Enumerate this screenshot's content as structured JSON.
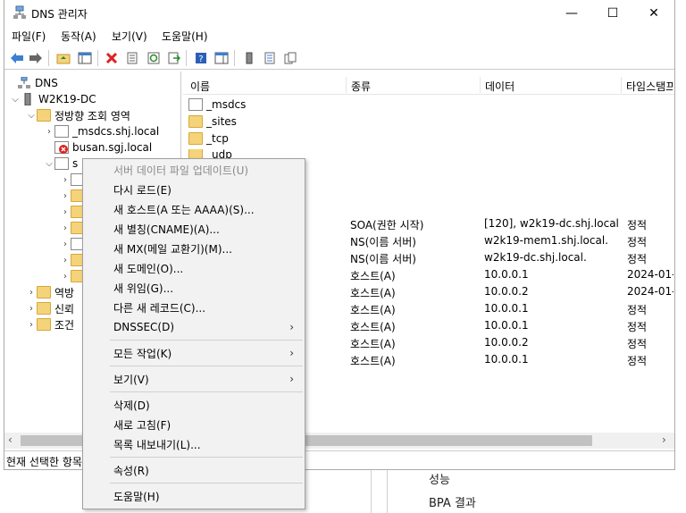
{
  "window": {
    "title": "DNS 관리자",
    "controls": {
      "minimize": "—",
      "maximize": "☐",
      "close": "✕"
    }
  },
  "menubar": [
    "파일(F)",
    "동작(A)",
    "보기(V)",
    "도움말(H)"
  ],
  "tree": {
    "root": "DNS",
    "server": "W2K19-DC",
    "forward_zones": "정방향 조회 영역",
    "zones": [
      "_msdcs.shj.local",
      "busan.sgj.local",
      "s"
    ],
    "others": [
      "역방",
      "신뢰",
      "조건"
    ]
  },
  "list": {
    "columns": [
      "이름",
      "종류",
      "데이터",
      "타임스탬프"
    ],
    "folders": [
      "_msdcs",
      "_sites",
      "_tcp",
      "_udp"
    ],
    "records": [
      {
        "type": "SOA(권한 시작)",
        "data": "[120], w2k19-dc.shj.local....",
        "ts": "정적"
      },
      {
        "type": "NS(이름 서버)",
        "data": "w2k19-mem1.shj.local.",
        "ts": "정적"
      },
      {
        "type": "NS(이름 서버)",
        "data": "w2k19-dc.shj.local.",
        "ts": "정적"
      },
      {
        "type": "호스트(A)",
        "data": "10.0.0.1",
        "ts": "2024-01-"
      },
      {
        "type": "호스트(A)",
        "data": "10.0.0.2",
        "ts": "2024-01-"
      },
      {
        "type": "호스트(A)",
        "data": "10.0.0.1",
        "ts": "정적"
      },
      {
        "type": "호스트(A)",
        "data": "10.0.0.1",
        "ts": "정적"
      },
      {
        "type": "호스트(A)",
        "data": "10.0.0.2",
        "ts": "정적"
      },
      {
        "type": "호스트(A)",
        "data": "10.0.0.1",
        "ts": "정적"
      }
    ]
  },
  "status": "현재 선택한 항목",
  "context_menu": {
    "items": [
      "서버 데이터 파일 업데이트(U)",
      "다시 로드(E)",
      "새 호스트(A 또는 AAAA)(S)...",
      "새 별칭(CNAME)(A)...",
      "새 MX(메일 교환기)(M)...",
      "새 도메인(O)...",
      "새 위임(G)...",
      "다른 새 레코드(C)...",
      "DNSSEC(D)",
      "모든 작업(K)",
      "보기(V)",
      "삭제(D)",
      "새로 고침(F)",
      "목록 내보내기(L)...",
      "속성(R)",
      "도움말(H)"
    ]
  },
  "background": {
    "items": [
      "성능",
      "BPA 결과"
    ]
  }
}
